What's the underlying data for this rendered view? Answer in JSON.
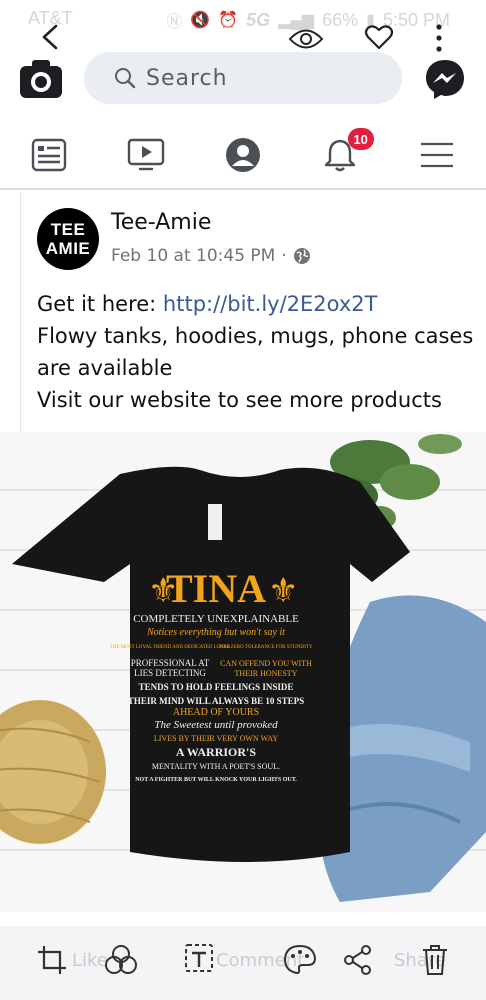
{
  "status_bar": {
    "carrier": "AT&T",
    "network": "5G",
    "battery": "66%",
    "time": "5:50 PM"
  },
  "search": {
    "placeholder": "Search"
  },
  "nav": {
    "notification_count": "10"
  },
  "post": {
    "author": "Tee-Amie",
    "avatar_text_line1": "TEE",
    "avatar_text_line2": "AMIE",
    "date": "Feb 10 at 10:45 PM",
    "separator": "·",
    "line1_prefix": "Get it here: ",
    "link": "http://bit.ly/2E2ox2T",
    "line2": "Flowy tanks, hoodies, mugs, phone cases are available",
    "line3": "Visit our website to see more products"
  },
  "photo": {
    "shirt_title": "TINA",
    "shirt_subtitle": "COMPLETELY UNEXPLAINABLE",
    "shirt_tagline": "Notices everything but won't say it",
    "shirt_left_box": "THE MOST LOYAL FRIEND AND DEDICATED LOVER",
    "shirt_right_box": "HAS ZERO TOLERANCE FOR STUPIDITY",
    "shirt_line_a": "PROFESSIONAL AT",
    "shirt_line_b": "LIES DETECTING",
    "shirt_line_c": "CAN OFFEND YOU WITH",
    "shirt_line_d": "THEIR HONESTY",
    "shirt_line_e": "TENDS TO HOLD FEELINGS INSIDE",
    "shirt_line_f": "THEIR MIND WILL ALWAYS BE 10 STEPS",
    "shirt_line_g": "AHEAD OF YOURS",
    "shirt_line_h": "The Sweetest until provoked",
    "shirt_line_i": "LIVES BY THEIR VERY OWN WAY",
    "shirt_line_j": "A WARRIOR'S",
    "shirt_line_k": "MENTALITY WITH A POET'S SOUL.",
    "shirt_line_l": "NOT A FIGHTER BUT WILL KNOCK YOUR LIGHTS OUT."
  },
  "actions": {
    "like_label": "Like",
    "comment_label": "Comment",
    "share_label": "Share"
  },
  "colors": {
    "link": "#3a5a94",
    "badge": "#e41e3f",
    "shirt_gold": "#f2a51a"
  }
}
